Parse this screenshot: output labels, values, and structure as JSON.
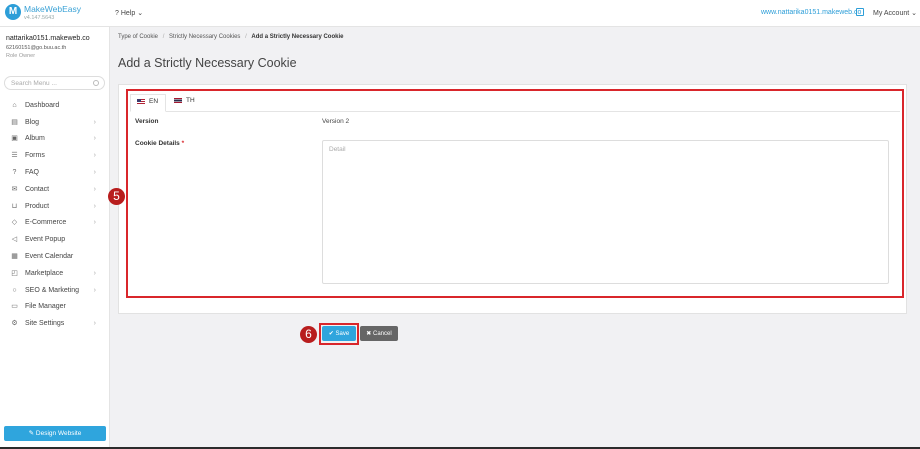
{
  "app": {
    "title": "MakeWebEasy",
    "version": "v4.147.5643"
  },
  "topbar": {
    "help_label": "Help",
    "site_link": "www.nattarika0151.makeweb.co",
    "my_account_label": "My Account"
  },
  "user": {
    "name": "nattarika0151.makeweb.co",
    "email": "62160151@go.buu.ac.th",
    "role": "Role Owner"
  },
  "search": {
    "placeholder": "Search Menu ..."
  },
  "sidebar": {
    "items": [
      {
        "label": "Dashboard",
        "icon": "home-icon",
        "has_children": false
      },
      {
        "label": "Blog",
        "icon": "document-icon",
        "has_children": true
      },
      {
        "label": "Album",
        "icon": "image-icon",
        "has_children": true
      },
      {
        "label": "Forms",
        "icon": "list-icon",
        "has_children": true
      },
      {
        "label": "FAQ",
        "icon": "question-icon",
        "has_children": true
      },
      {
        "label": "Contact",
        "icon": "mail-icon",
        "has_children": true
      },
      {
        "label": "Product",
        "icon": "cart-icon",
        "has_children": true
      },
      {
        "label": "E-Commerce",
        "icon": "tag-icon",
        "has_children": true
      },
      {
        "label": "Event Popup",
        "icon": "megaphone-icon",
        "has_children": false
      },
      {
        "label": "Event Calendar",
        "icon": "calendar-icon",
        "has_children": false
      },
      {
        "label": "Marketplace",
        "icon": "bag-icon",
        "has_children": true
      },
      {
        "label": "SEO & Marketing",
        "icon": "search-icon",
        "has_children": true
      },
      {
        "label": "File Manager",
        "icon": "folder-icon",
        "has_children": false
      },
      {
        "label": "Site Settings",
        "icon": "gear-icon",
        "has_children": true
      }
    ],
    "design_button": "Design Website"
  },
  "breadcrumb": [
    "Type of Cookie",
    "Strictly Necessary Cookies",
    "Add a Strictly Necessary Cookie"
  ],
  "page_title": "Add a Strictly Necessary Cookie",
  "tabs": [
    {
      "label": "EN",
      "active": true
    },
    {
      "label": "TH",
      "active": false
    }
  ],
  "form": {
    "version_label": "Version",
    "version_value": "Version 2",
    "details_label": "Cookie Details",
    "required_mark": "*",
    "details_placeholder": "Detail",
    "save_label": "Save",
    "cancel_label": "Cancel"
  },
  "annotations": {
    "step5": "5",
    "step6": "6"
  },
  "colors": {
    "accent": "#2fa5dd",
    "highlight": "#d9262b",
    "badge": "#b81d1d"
  }
}
